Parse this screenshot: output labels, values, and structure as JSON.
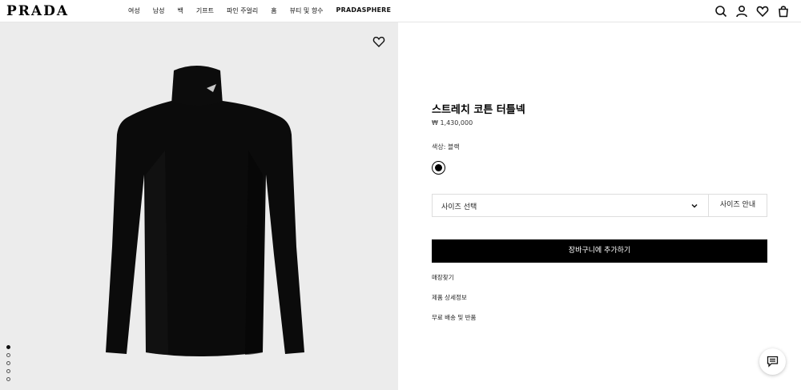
{
  "header": {
    "logo": "PRADA",
    "nav": [
      "여성",
      "남성",
      "백",
      "기프트",
      "파인 주얼리",
      "홈",
      "뷰티 및 향수",
      "PRADASPHERE"
    ],
    "icons": [
      "search-icon",
      "account-icon",
      "wishlist-icon",
      "bag-icon"
    ]
  },
  "gallery": {
    "image_count": 5,
    "active_index": 0,
    "wishlist_icon": "heart-icon",
    "background": "#ececec"
  },
  "product": {
    "title": "스트레치 코튼 터틀넥",
    "price": "₩ 1,430,000",
    "color_label": "색상: 블랙",
    "swatch_color": "#000000",
    "size_placeholder": "사이즈 선택",
    "size_guide": "사이즈 안내",
    "add_to_cart": "장바구니에 추가하기",
    "links": [
      "매장찾기",
      "제품 상세정보",
      "무료 배송 및 반품"
    ]
  },
  "chat": {
    "icon": "chat-icon"
  }
}
